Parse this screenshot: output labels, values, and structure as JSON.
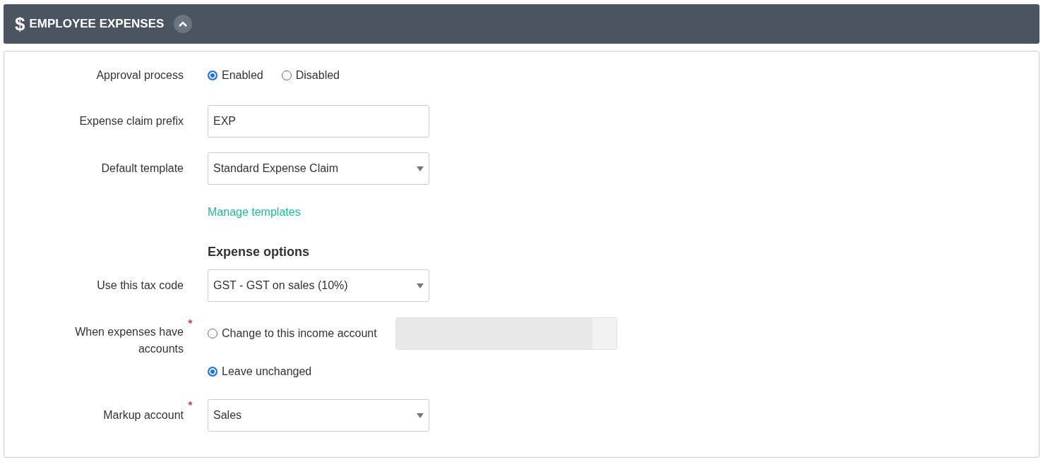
{
  "header": {
    "symbol": "$",
    "title": "EMPLOYEE EXPENSES",
    "expanded": true
  },
  "rows": [
    {
      "kind": "radios",
      "label": "Approval process",
      "options": [
        {
          "label": "Enabled",
          "selected": true
        },
        {
          "label": "Disabled",
          "selected": false
        }
      ]
    },
    {
      "kind": "text",
      "label": "Expense claim prefix",
      "value": "EXP"
    },
    {
      "kind": "select",
      "label": "Default template",
      "value": "Standard Expense Claim"
    },
    {
      "kind": "link",
      "text": "Manage templates"
    },
    {
      "kind": "heading",
      "text": "Expense options"
    },
    {
      "kind": "select",
      "label": "Use this tax code",
      "value": "GST - GST on sales (10%)"
    },
    {
      "kind": "radio_stack",
      "label": "When expenses have accounts",
      "required_mark": "*",
      "options": [
        {
          "label": "Change to this income account",
          "selected": false,
          "account_field": {
            "disabled": true
          }
        },
        {
          "label": "Leave unchanged",
          "selected": true
        }
      ]
    },
    {
      "kind": "select",
      "label": "Markup account",
      "required_mark": "*",
      "value": "Sales"
    }
  ]
}
